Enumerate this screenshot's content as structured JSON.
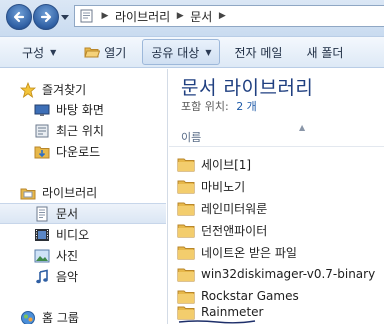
{
  "address_bar": {
    "crumbs": [
      "라이브러리",
      "문서"
    ]
  },
  "toolbar": {
    "organize": "구성",
    "open": "열기",
    "share_with": "공유 대상",
    "email": "전자 메일",
    "new_folder": "새 폴더"
  },
  "nav": {
    "favorites": "즐겨찾기",
    "desktop": "바탕 화면",
    "recent_places": "최근 위치",
    "downloads": "다운로드",
    "libraries": "라이브러리",
    "documents": "문서",
    "videos": "비디오",
    "pictures": "사진",
    "music": "음악",
    "homegroup": "홈 그룹"
  },
  "content": {
    "library_title": "문서 라이브러리",
    "includes_label": "포함 위치:",
    "location_count": "2 개",
    "column_name": "이름",
    "files": [
      "세이브[1]",
      "마비노기",
      "레인미터워룬",
      "던전앤파이터",
      "네이트온 받은 파일",
      "win32diskimager-v0.7-binary",
      "Rockstar Games",
      "Rainmeter"
    ]
  },
  "colors": {
    "accent_title": "#1f3f80",
    "selection": "#dbe6f4",
    "folder": "#e7b84a"
  }
}
